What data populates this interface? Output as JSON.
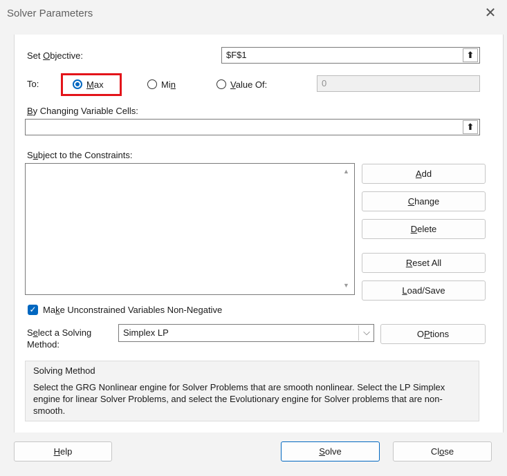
{
  "window": {
    "title": "Solver Parameters",
    "close_glyph": "✕"
  },
  "objective": {
    "label_pre": "Set ",
    "label_key": "O",
    "label_post": "bjective:",
    "value": "$F$1",
    "ref_icon": "⬆"
  },
  "to": {
    "label": "To:",
    "max": {
      "key": "M",
      "rest": "ax",
      "selected": true
    },
    "min": {
      "pre": "Mi",
      "key": "n",
      "selected": false
    },
    "value_of": {
      "key": "V",
      "rest": "alue Of:",
      "selected": false,
      "value": "0"
    }
  },
  "changing": {
    "key": "B",
    "rest": "y Changing Variable Cells:",
    "value": "",
    "ref_icon": "⬆"
  },
  "constraints": {
    "pre": "S",
    "key": "u",
    "rest": "bject to the Constraints:",
    "scroll_up": "▲",
    "scroll_down": "▼"
  },
  "side_buttons": {
    "add": {
      "key": "A",
      "rest": "dd"
    },
    "change": {
      "key": "C",
      "rest": "hange"
    },
    "delete": {
      "key": "D",
      "rest": "elete"
    },
    "reset": {
      "key": "R",
      "rest": "eset All"
    },
    "loadsave": {
      "key": "L",
      "rest": "oad/Save"
    }
  },
  "nonneg": {
    "checked": true,
    "check_glyph": "✓",
    "pre": "Ma",
    "key": "k",
    "rest": "e Unconstrained Variables Non-Negative"
  },
  "method": {
    "label_line1_pre": "S",
    "label_line1_key": "e",
    "label_line1_rest": "lect a Solving",
    "label_line2": "Method:",
    "selected": "Simplex LP",
    "dropdown_glyph": "⌵",
    "options_key": "P",
    "options_pre": "O",
    "options_rest": "tions"
  },
  "info": {
    "heading": "Solving Method",
    "text": "Select the GRG Nonlinear engine for Solver Problems that are smooth nonlinear. Select the LP Simplex engine for linear Solver Problems, and select the Evolutionary engine for Solver problems that are non-smooth."
  },
  "footer": {
    "help": {
      "key": "H",
      "rest": "elp"
    },
    "solve": {
      "key": "S",
      "rest": "olve"
    },
    "close": {
      "pre": "Cl",
      "key": "o",
      "rest": "se"
    }
  },
  "colors": {
    "accent": "#0067c0",
    "highlight": "#e3141a"
  }
}
